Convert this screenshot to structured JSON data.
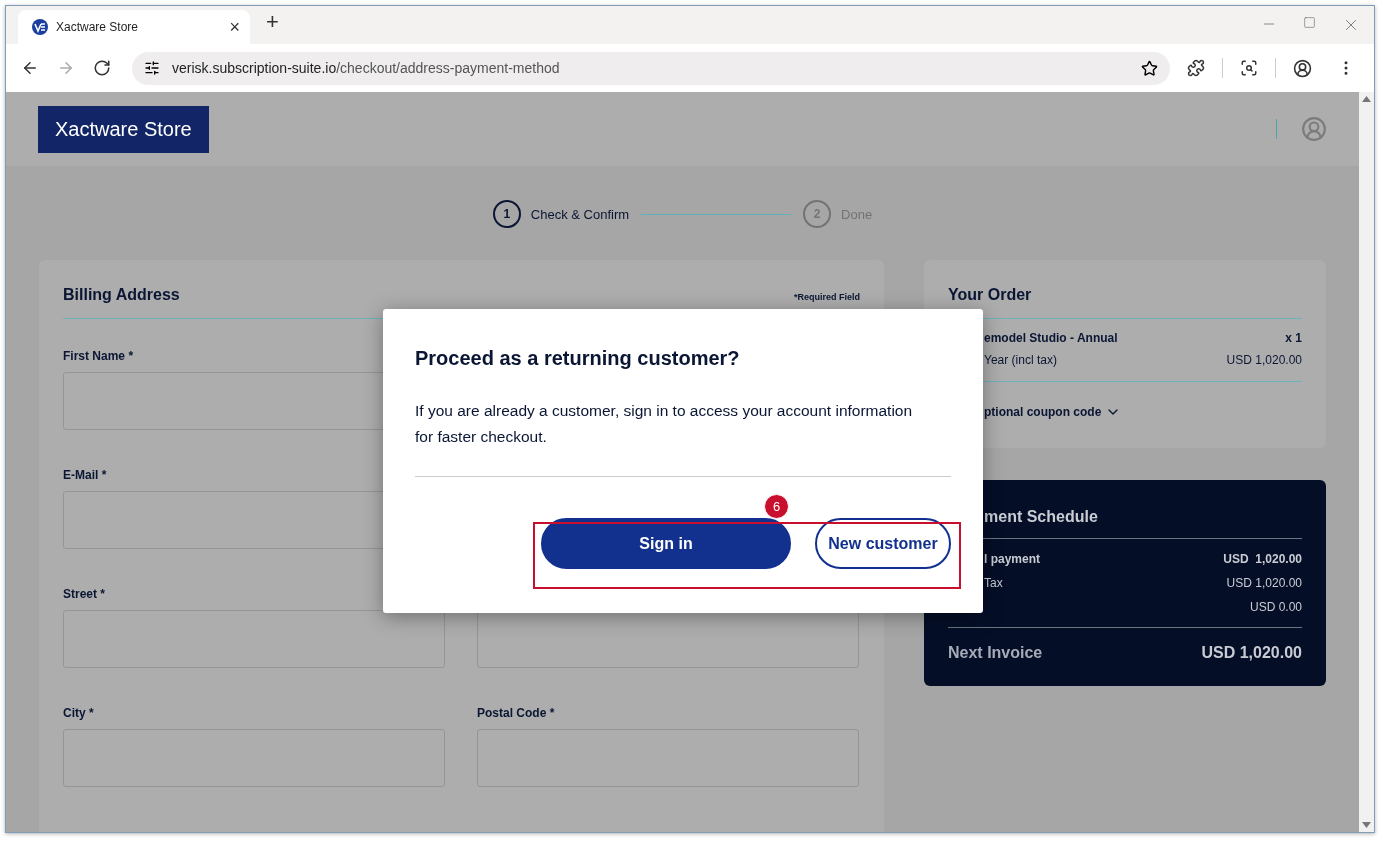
{
  "browser": {
    "tab_title": "Xactware Store",
    "tab_close": "×",
    "new_tab": "+",
    "url_host": "verisk.subscription-suite.io",
    "url_path": "/checkout/address-payment-method",
    "nav": [
      {
        "kind": "back",
        "disabled": false
      },
      {
        "kind": "forward",
        "disabled": true
      },
      {
        "kind": "reload",
        "disabled": false
      }
    ]
  },
  "site": {
    "logo": "Xactware Store"
  },
  "stepper": [
    {
      "number": "1",
      "label": "Check & Confirm",
      "selected": true
    },
    {
      "number": "2",
      "label": "Done",
      "selected": false
    }
  ],
  "billing": {
    "title": "Billing Address",
    "required_note": "*Required Field",
    "rows": [
      [
        {
          "kind": "text_field",
          "label": "First Name",
          "marker": "*"
        }
      ],
      [
        {
          "kind": "text_field",
          "label": "E-Mail",
          "marker": "*"
        }
      ],
      [
        {
          "kind": "text_field",
          "label": "Street",
          "marker": "*"
        },
        {
          "kind": "text_field"
        }
      ],
      [
        {
          "kind": "text_field",
          "label": "City",
          "marker": "*"
        },
        {
          "kind": "text_field",
          "label": "Postal Code",
          "marker": "*"
        }
      ]
    ]
  },
  "order": {
    "title": "Your Order",
    "product": "emodel Studio - Annual",
    "quantity": "x 1",
    "period": "Year (incl tax)",
    "price": "USD 1,020.00",
    "coupon": "ptional coupon code"
  },
  "schedule": {
    "title": "ment Schedule",
    "rows": [
      {
        "label": "l payment",
        "value": "USD  1,020.00",
        "bold": true
      },
      {
        "label": "Tax",
        "value": "USD 1,020.00",
        "bold": false
      },
      {
        "value": "USD 0.00",
        "bold": false
      }
    ],
    "total_label": "Next Invoice",
    "total_value": "USD 1,020.00"
  },
  "modal": {
    "title": "Proceed as a returning customer?",
    "body": "If you are already a customer, sign in to access your account information for faster checkout.",
    "buttons": [
      {
        "label": "Sign in",
        "kind": "primary"
      },
      {
        "label": "New customer",
        "kind": "secondary"
      }
    ]
  },
  "annotation": {
    "number": "6"
  }
}
